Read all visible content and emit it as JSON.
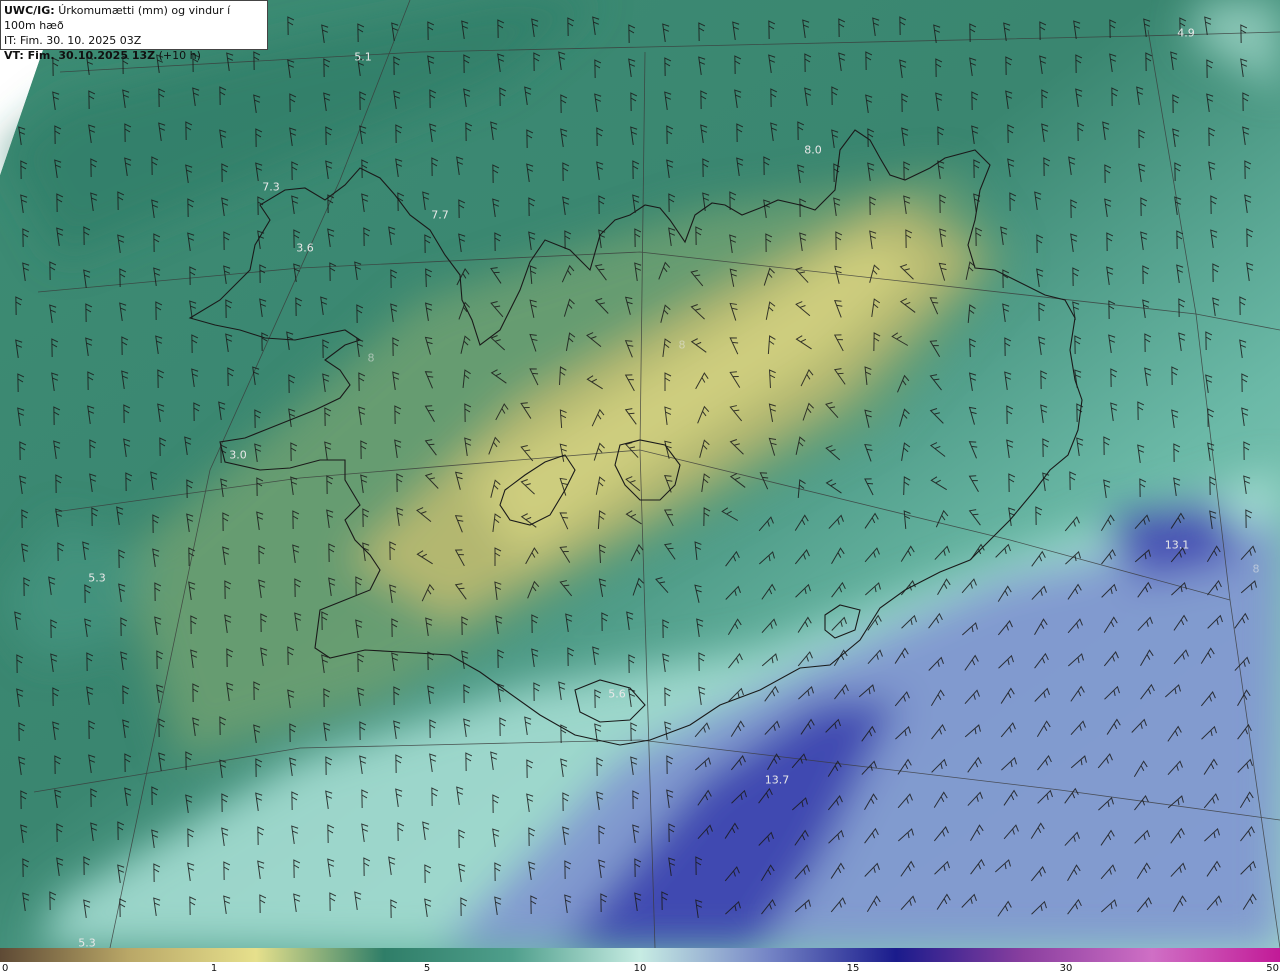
{
  "header": {
    "title_bold": "UWC/IG:",
    "title_text": "Úrkomumætti (mm) og vindur í 100m hæð",
    "it_line": "IT: Fim. 30. 10. 2025 03Z",
    "vt_bold": "VT: Fim. 30.10.2025 13Z",
    "vt_rest": "(+10 h)"
  },
  "value_labels": [
    "5.1",
    "4.9",
    "8.0",
    "7.3",
    "7.7",
    "3.6",
    "3.0",
    "5.3",
    "13.1",
    "5.6",
    "13.7",
    "5.3",
    "8",
    "8",
    "8"
  ],
  "colorbar": {
    "ticks": [
      "0",
      "1",
      "5",
      "10",
      "15",
      "30",
      "50"
    ],
    "stops": [
      "#5e4a35",
      "#b9a767",
      "#e6e08c",
      "#2f7e68",
      "#4f9f8c",
      "#c7ece3",
      "#7585c6",
      "#1a1b8c",
      "#8a3f9f",
      "#cf6fc5",
      "#c21a97"
    ]
  },
  "colors": {
    "sea_green": "#3a8470",
    "land_yellow": "#c9c977",
    "land_green": "#3f8a6c",
    "light_cyan": "#a8dcd2",
    "blue": "#4a56b8",
    "navy": "#2a2a9a"
  }
}
